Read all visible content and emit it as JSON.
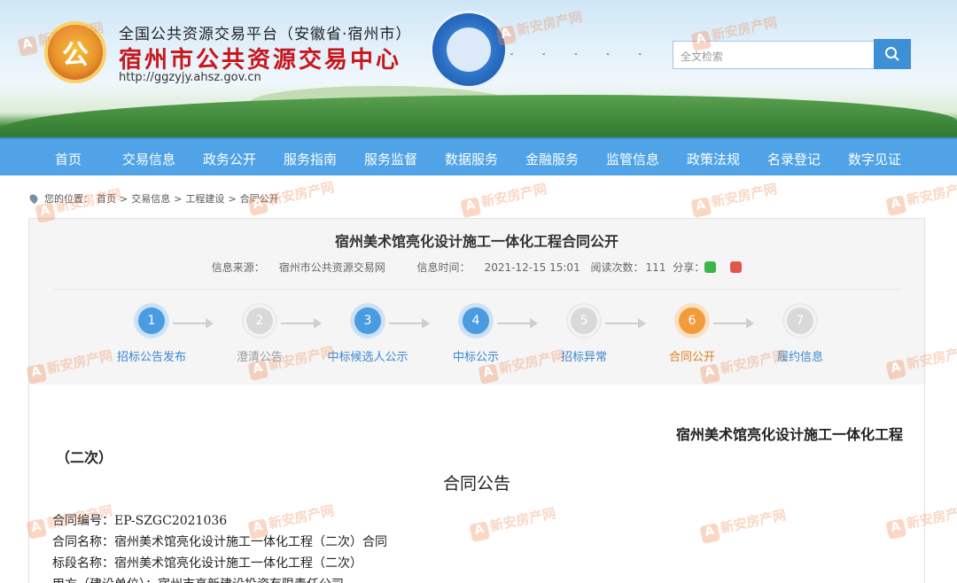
{
  "header": {
    "logo_char": "公",
    "subtitle": "全国公共资源交易平台（安徽省·宿州市）",
    "title": "宿州市公共资源交易中心",
    "url": "http://ggzyjy.ahsz.gov.cn",
    "search_placeholder": "全文检索"
  },
  "nav": {
    "items": [
      "首页",
      "交易信息",
      "政务公开",
      "服务指南",
      "服务监督",
      "数据服务",
      "金融服务",
      "监管信息",
      "政策法规",
      "名录登记",
      "数字见证"
    ]
  },
  "breadcrumb": {
    "prefix": "您的位置：",
    "items": [
      "首页",
      "交易信息",
      "工程建设",
      "合同公开"
    ],
    "separator": ">"
  },
  "article": {
    "title": "宿州美术馆亮化设计施工一体化工程合同公开",
    "source_label": "信息来源：",
    "source": "宿州市公共资源交易网",
    "time_label": "信息时间：",
    "time": "2021-12-15 15:01",
    "views_label": "阅读次数：",
    "views": "111",
    "share_label": "分享："
  },
  "steps": [
    {
      "num": "1",
      "label": "招标公告发布",
      "state": "done"
    },
    {
      "num": "2",
      "label": "澄清公告",
      "state": "inactive"
    },
    {
      "num": "3",
      "label": "中标候选人公示",
      "state": "done"
    },
    {
      "num": "4",
      "label": "中标公示",
      "state": "done"
    },
    {
      "num": "5",
      "label": "招标异常",
      "state": "inactive"
    },
    {
      "num": "6",
      "label": "合同公开",
      "state": "current"
    },
    {
      "num": "7",
      "label": "履约信息",
      "state": "inactive"
    }
  ],
  "content": {
    "project_title": "宿州美术馆亮化设计施工一体化工程",
    "project_sub": "（二次）",
    "notice_title": "合同公告",
    "lines": [
      "合同编号：EP-SZGC2021036",
      "合同名称：宿州美术馆亮化设计施工一体化工程（二次）合同",
      "标段名称：宿州美术馆亮化设计施工一体化工程（二次）",
      "甲方（建设单位）：宿州市高新建设投资有限责任公司"
    ]
  },
  "watermark": {
    "text": "新安房产网",
    "logo": "A"
  },
  "colors": {
    "nav_bg": "#4fa3e6",
    "title_red": "#c8161d",
    "step_blue": "#4a9be0",
    "step_orange": "#f29b3a",
    "step_grey": "#d9d9d9"
  }
}
